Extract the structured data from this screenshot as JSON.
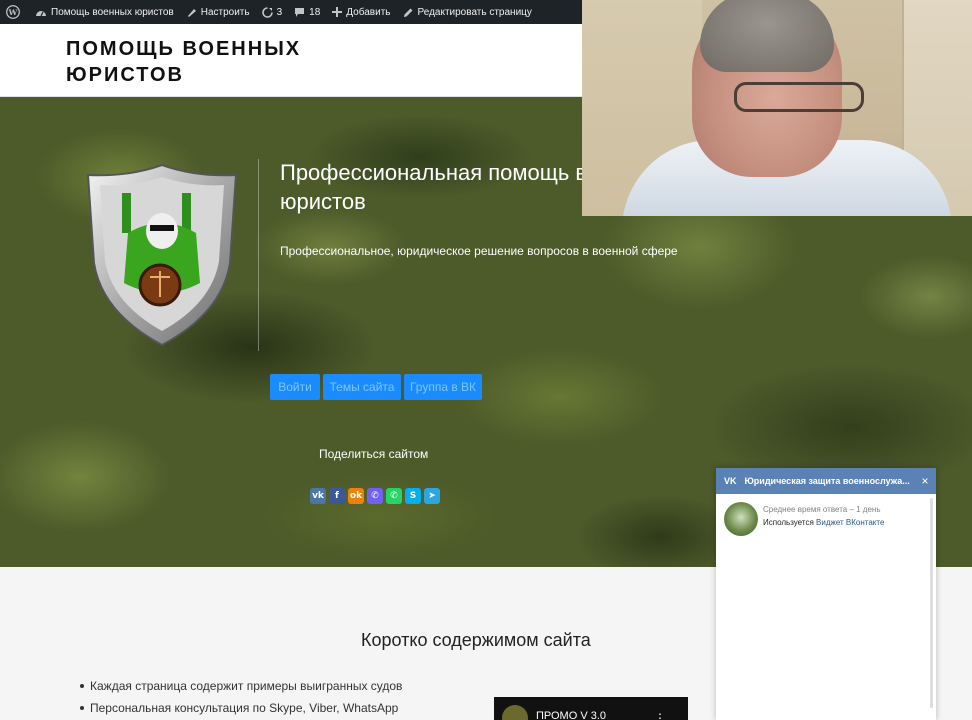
{
  "admin_bar": {
    "site_name": "Помощь военных юристов",
    "customize": "Настроить",
    "updates_count": "3",
    "comments_count": "18",
    "add_new": "Добавить",
    "edit_page": "Редактировать страницу"
  },
  "header": {
    "site_title": "ПОМОЩЬ ВОЕННЫХ ЮРИСТОВ"
  },
  "hero": {
    "title": "Профессиональная помощь военных юристов",
    "description": "Профессиональное, юридическое решение вопросов в военной сфере",
    "buttons": {
      "login": "Войти",
      "themes": "Темы сайта",
      "vk_group": "Группа в ВК"
    },
    "share_label": "Поделиться сайтом",
    "share_icons": [
      {
        "name": "vk-share-icon",
        "glyph": "vk",
        "color": "#4a76a8"
      },
      {
        "name": "facebook-share-icon",
        "glyph": "f",
        "color": "#3b5998"
      },
      {
        "name": "odnoklassniki-share-icon",
        "glyph": "ok",
        "color": "#ee8208"
      },
      {
        "name": "viber-share-icon",
        "glyph": "✆",
        "color": "#7360f2"
      },
      {
        "name": "whatsapp-share-icon",
        "glyph": "✆",
        "color": "#25d366"
      },
      {
        "name": "skype-share-icon",
        "glyph": "S",
        "color": "#00aff0"
      },
      {
        "name": "telegram-share-icon",
        "glyph": "➤",
        "color": "#2ca5e0"
      }
    ]
  },
  "content": {
    "title": "Коротко содержимом сайта",
    "features": [
      "Каждая страница содержит примеры выигранных судов",
      "Персональная консультация по Skype, Viber, WhatsApp"
    ],
    "video_title": "ПРОМО V 3.0"
  },
  "vk_widget": {
    "logo": "VK",
    "title": "Юридическая защита военнослужа...",
    "close": "×",
    "response_time": "Среднее время ответа – 1 день",
    "used_prefix": "Используется",
    "used_link": "Виджет ВКонтакте"
  },
  "colors": {
    "admin_bar": "#1d2327",
    "hero_button": "#1a8cff",
    "vk_header": "#5b82b5"
  }
}
